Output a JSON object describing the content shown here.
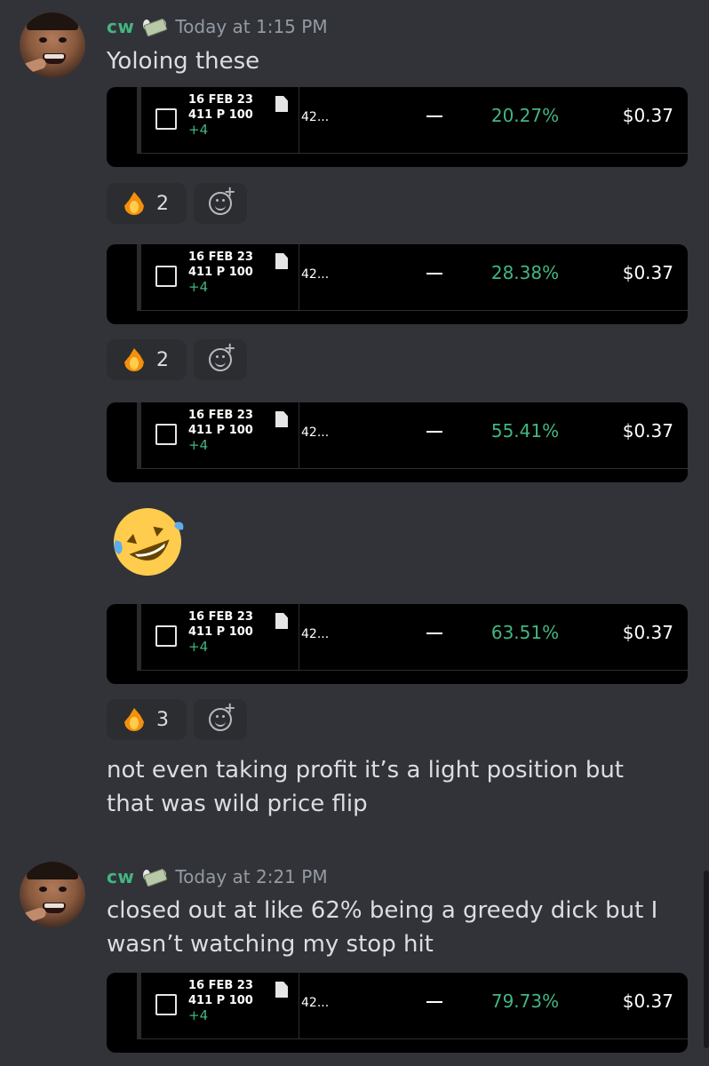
{
  "messages": [
    {
      "username": "cw",
      "timestamp": "Today at 1:15 PM",
      "text": "Yoloing these"
    },
    {
      "username": "cw",
      "timestamp": "Today at 2:21 PM",
      "text": "closed out at like 62% being a greedy dick but I wasn’t watching my stop hit"
    }
  ],
  "inline_text": "not even taking profit it’s a light position but that was wild price flip",
  "cards": [
    {
      "date": "16 FEB 23",
      "contract": "411 P 100",
      "plus": "+4",
      "code": "42...",
      "pct": "20.27%",
      "price": "$0.37"
    },
    {
      "date": "16 FEB 23",
      "contract": "411 P 100",
      "plus": "+4",
      "code": "42...",
      "pct": "28.38%",
      "price": "$0.37"
    },
    {
      "date": "16 FEB 23",
      "contract": "411 P 100",
      "plus": "+4",
      "code": "42...",
      "pct": "55.41%",
      "price": "$0.37"
    },
    {
      "date": "16 FEB 23",
      "contract": "411 P 100",
      "plus": "+4",
      "code": "42...",
      "pct": "63.51%",
      "price": "$0.37"
    },
    {
      "date": "16 FEB 23",
      "contract": "411 P 100",
      "plus": "+4",
      "code": "42...",
      "pct": "79.73%",
      "price": "$0.37"
    }
  ],
  "reactions": [
    {
      "emoji": "fire-icon",
      "count": "2"
    },
    {
      "emoji": "fire-icon",
      "count": "2"
    },
    {
      "emoji": "fire-icon",
      "count": "3"
    }
  ],
  "colors": {
    "background": "#313338",
    "username": "#43b581",
    "gain": "#43b581",
    "timestamp": "#949ba4"
  }
}
